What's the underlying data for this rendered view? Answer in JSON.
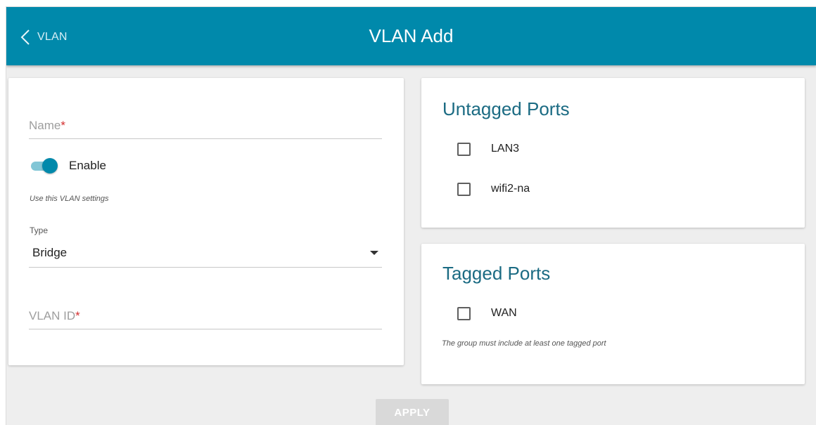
{
  "header": {
    "back_label": "VLAN",
    "title": "VLAN Add",
    "color": "#0089ab"
  },
  "form": {
    "name_placeholder": "Name",
    "required_mark": "*",
    "enable_label": "Enable",
    "enable_state": true,
    "enable_hint": "Use this VLAN settings",
    "type_label": "Type",
    "type_value": "Bridge",
    "vlan_id_placeholder": "VLAN ID"
  },
  "untagged": {
    "title": "Untagged Ports",
    "ports": [
      {
        "label": "LAN3",
        "checked": false
      },
      {
        "label": "wifi2-na",
        "checked": false
      }
    ]
  },
  "tagged": {
    "title": "Tagged Ports",
    "ports": [
      {
        "label": "WAN",
        "checked": false
      }
    ],
    "hint": "The group must include at least one tagged port"
  },
  "actions": {
    "apply_label": "APPLY"
  },
  "icons": {
    "back": "chevron-left-icon",
    "select": "caret-down-icon"
  }
}
